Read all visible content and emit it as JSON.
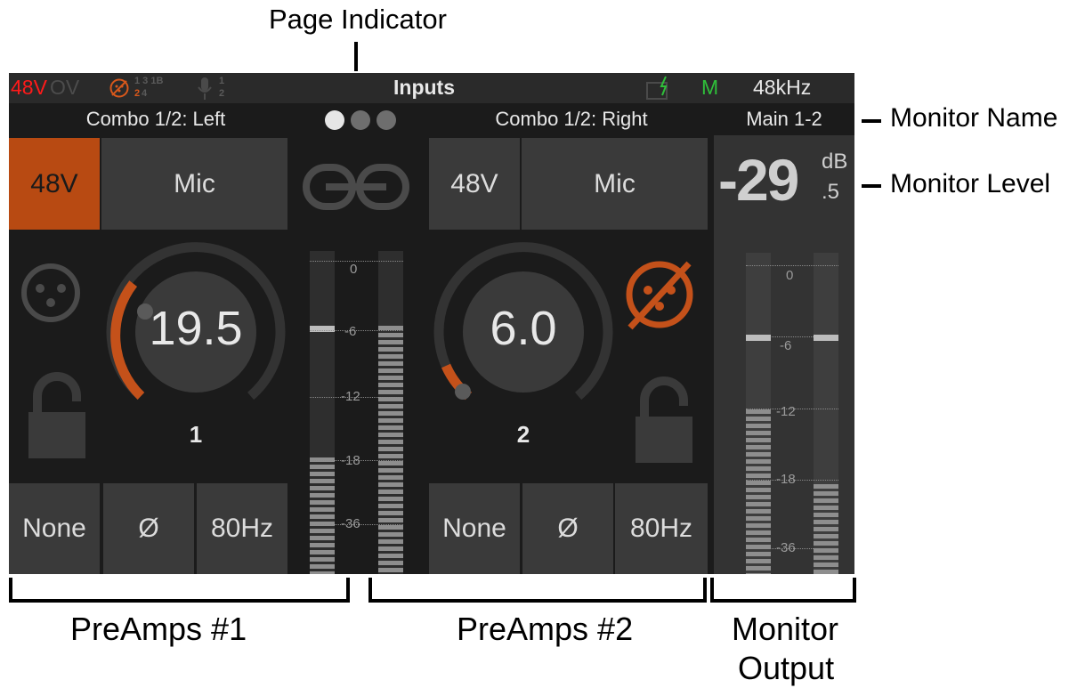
{
  "annotations": {
    "page_indicator": "Page Indicator",
    "monitor_name": "Monitor Name",
    "monitor_level": "Monitor Level",
    "preamps_1": "PreAmps #1",
    "preamps_2": "PreAmps #2",
    "monitor_output_line1": "Monitor",
    "monitor_output_line2": "Output"
  },
  "status_bar": {
    "phantom": "48V",
    "overload": "OV",
    "ch_top": "1  3 1B",
    "ch_bottom_active": "2",
    "ch_bottom_rest": " 4",
    "mic_top": "1",
    "mic_bottom": "2",
    "title": "Inputs",
    "mode": "M",
    "sample_rate": "48kHz",
    "colors": {
      "phantom": "#ff1a1a",
      "mode": "#2fbf3a",
      "accent": "#d8581b"
    }
  },
  "page_dots": {
    "count": 3,
    "active": 0
  },
  "preamp_1": {
    "name": "Combo 1/2: Left",
    "phantom_label": "48V",
    "phantom_on": true,
    "source_label": "Mic",
    "gain": "19.5",
    "channel": "1",
    "locked": false,
    "buttons": [
      "None",
      "Ø",
      "80Hz"
    ]
  },
  "preamp_2": {
    "name": "Combo 1/2: Right",
    "phantom_label": "48V",
    "phantom_on": false,
    "source_label": "Mic",
    "gain": "6.0",
    "channel": "2",
    "locked": false,
    "buttons": [
      "None",
      "Ø",
      "80Hz"
    ]
  },
  "preamp_meter": {
    "ticks": [
      "0",
      "-6",
      "-12",
      "-18",
      "-36"
    ]
  },
  "monitor": {
    "name": "Main 1-2",
    "level_int": "-29",
    "level_frac": ".5",
    "unit": "dB",
    "ticks": [
      "0",
      "-6",
      "-12",
      "-18",
      "-36"
    ]
  }
}
